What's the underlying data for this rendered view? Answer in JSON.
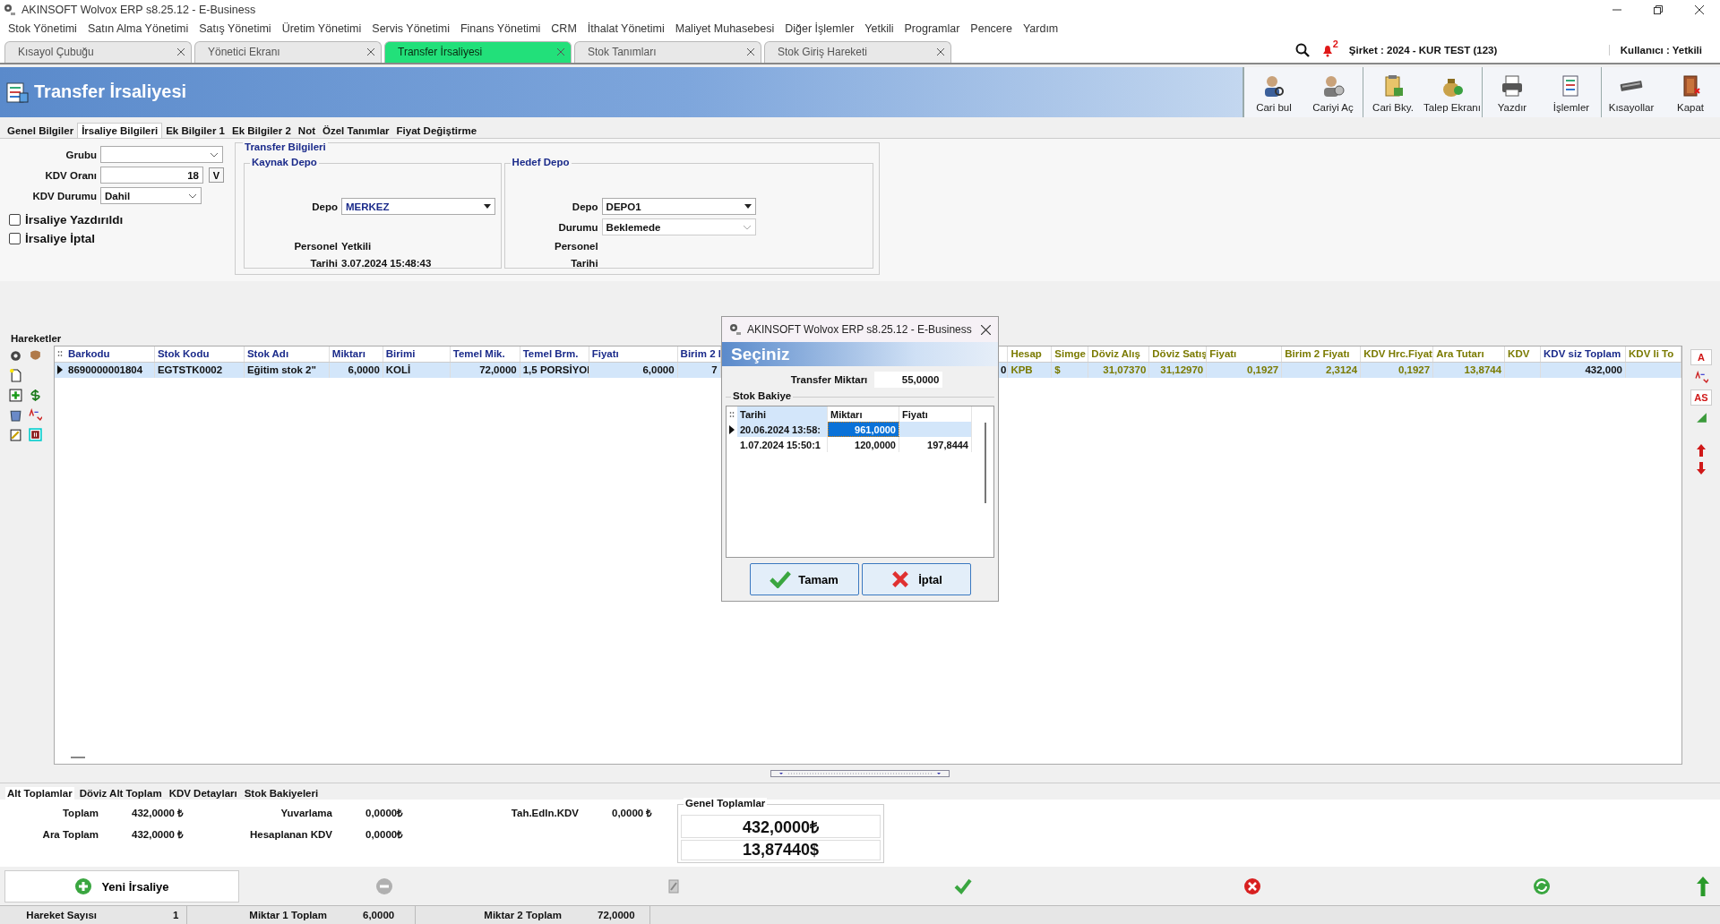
{
  "window": {
    "title": "AKINSOFT Wolvox ERP s8.25.12 - E-Business"
  },
  "menu": [
    "Stok Yönetimi",
    "Satın Alma Yönetimi",
    "Satış Yönetimi",
    "Üretim Yönetimi",
    "Servis Yönetimi",
    "Finans Yönetimi",
    "CRM",
    "İthalat Yönetimi",
    "Maliyet Muhasebesi",
    "Diğer İşlemler",
    "Yetkili",
    "Programlar",
    "Pencere",
    "Yardım"
  ],
  "tabs": [
    {
      "label": "Kısayol Çubuğu",
      "selected": false
    },
    {
      "label": "Yönetici Ekranı",
      "selected": false
    },
    {
      "label": "Transfer İrsaliyesi",
      "selected": true
    },
    {
      "label": "Stok Tanımları",
      "selected": false
    },
    {
      "label": "Stok Giriş Hareketi",
      "selected": false
    }
  ],
  "notification_count": "2",
  "company": "Şirket : 2024 - KUR TEST (123)",
  "user": "Kullanıcı : Yetkili",
  "header": {
    "title": "Transfer İrsaliyesi",
    "toolbar": [
      "Cari bul",
      "Cariyi Aç",
      "Cari Bky.",
      "Talep Ekranı",
      "Yazdır",
      "İşlemler",
      "Kısayollar",
      "Kapat"
    ]
  },
  "subtabs": [
    {
      "label": "Genel Bilgiler",
      "selected": false
    },
    {
      "label": "İrsaliye Bilgileri",
      "selected": true
    },
    {
      "label": "Ek Bilgiler 1",
      "selected": false
    },
    {
      "label": "Ek Bilgiler 2",
      "selected": false
    },
    {
      "label": "Not",
      "selected": false
    },
    {
      "label": "Özel Tanımlar",
      "selected": false
    },
    {
      "label": "Fiyat Değiştirme",
      "selected": false
    }
  ],
  "form": {
    "group_label": "Grubu",
    "vat_rate_label": "KDV Oranı",
    "vat_rate": "18",
    "vat_button": "V",
    "vat_status_label": "KDV Durumu",
    "vat_status": "Dahil",
    "checkboxes": [
      {
        "label": "İrsaliye Yazdırıldı",
        "checked": false
      },
      {
        "label": "İrsaliye İptal",
        "checked": false
      }
    ]
  },
  "transfer": {
    "title": "Transfer Bilgileri",
    "source": {
      "title": "Kaynak Depo",
      "depot_label": "Depo",
      "depot": "MERKEZ",
      "personnel_label": "Personel",
      "personnel": "Yetkili",
      "date_label": "Tarihi",
      "date": "3.07.2024 15:48:43"
    },
    "target": {
      "title": "Hedef Depo",
      "depot_label": "Depo",
      "depot": "DEPO1",
      "status_label": "Durumu",
      "status": "Beklemede",
      "personnel_label": "Personel",
      "date_label": "Tarihi"
    }
  },
  "movements": {
    "title": "Hareketler",
    "row_selected": true,
    "columns_left": [
      {
        "header": "Barkodu",
        "cell": "8690000001804",
        "kind": "text"
      },
      {
        "header": "Stok Kodu",
        "cell": "EGTSTK0002",
        "kind": "text"
      },
      {
        "header": "Stok Adı",
        "cell": "Eğitim stok 2\"",
        "kind": "text"
      },
      {
        "header": "Miktarı",
        "cell": "6,0000",
        "kind": "number"
      },
      {
        "header": "Birimi",
        "cell": "KOLİ",
        "kind": "text"
      },
      {
        "header": "Temel Mik.",
        "cell": "72,0000",
        "kind": "number"
      },
      {
        "header": "Temel Brm.",
        "cell": "1,5 PORSİYOI",
        "kind": "text"
      },
      {
        "header": "Fiyatı",
        "cell": "6,0000",
        "kind": "number"
      },
      {
        "header": "Birim 2 I",
        "cell": "7",
        "kind": "number"
      }
    ],
    "columns_right": [
      {
        "cell": "0",
        "kind": "number"
      },
      {
        "header": "Hesap",
        "cell": "KPB",
        "kind": "fx_text"
      },
      {
        "header": "Simge",
        "cell": "$",
        "kind": "fx_text"
      },
      {
        "header": "Döviz Alış",
        "cell": "31,07370",
        "kind": "fx_number"
      },
      {
        "header": "Döviz Satış",
        "cell": "31,12970",
        "kind": "fx_number"
      },
      {
        "header": "Fiyatı",
        "cell": "0,1927",
        "kind": "fx_number"
      },
      {
        "header": "Birim 2 Fiyatı",
        "cell": "2,3124",
        "kind": "fx_number"
      },
      {
        "header": "KDV Hrc.Fiyat",
        "cell": "0,1927",
        "kind": "fx_number"
      },
      {
        "header": "Ara Tutarı",
        "cell": "13,8744",
        "kind": "fx_number"
      },
      {
        "header": "KDV",
        "kind": "fx_number"
      },
      {
        "header": "KDV siz Toplam",
        "cell": "432,000",
        "kind": "number"
      },
      {
        "header": "KDV li To",
        "kind": "fx_number"
      }
    ],
    "side_letters": [
      "A",
      "AS"
    ]
  },
  "bottom_tabs": [
    {
      "label": "Alt Toplamlar",
      "selected": true
    },
    {
      "label": "Döviz Alt Toplam",
      "selected": false
    },
    {
      "label": "KDV Detayları",
      "selected": false
    },
    {
      "label": "Stok Bakiyeleri",
      "selected": false
    }
  ],
  "totals": [
    {
      "label": "Toplam",
      "value": "432,0000 ₺"
    },
    {
      "label": "Yuvarlama",
      "value": "0,0000₺"
    },
    {
      "label": "Tah.Edln.KDV",
      "value": "0,0000 ₺"
    },
    {
      "label": "Ara Toplam",
      "value": "432,0000 ₺"
    },
    {
      "label": "Hesaplanan KDV",
      "value": "0,0000₺"
    }
  ],
  "grand_totals": {
    "title": "Genel Toplamlar",
    "values": [
      "432,0000₺",
      "13,87440$"
    ]
  },
  "new_button": "Yeni İrsaliye",
  "status_bar": [
    {
      "label": "Hareket Sayısı",
      "value": "1"
    },
    {
      "label": "Miktar 1 Toplam",
      "value": "6,0000"
    },
    {
      "label": "Miktar 2 Toplam",
      "value": "72,0000"
    }
  ],
  "dialog": {
    "title": "AKINSOFT Wolvox ERP s8.25.12 - E-Business",
    "heading": "Seçiniz",
    "amount_label": "Transfer Miktarı",
    "amount": "55,0000",
    "group": "Stok Bakiye",
    "columns": [
      "Tarihi",
      "Miktarı",
      "Fiyatı"
    ],
    "rows": [
      {
        "selected": true,
        "cells": [
          "20.06.2024 13:58:",
          "961,0000"
        ]
      },
      {
        "selected": false,
        "cells": [
          "1.07.2024 15:50:1",
          "120,0000",
          "197,8444"
        ]
      }
    ],
    "buttons": [
      "Tamam",
      "İptal"
    ]
  }
}
